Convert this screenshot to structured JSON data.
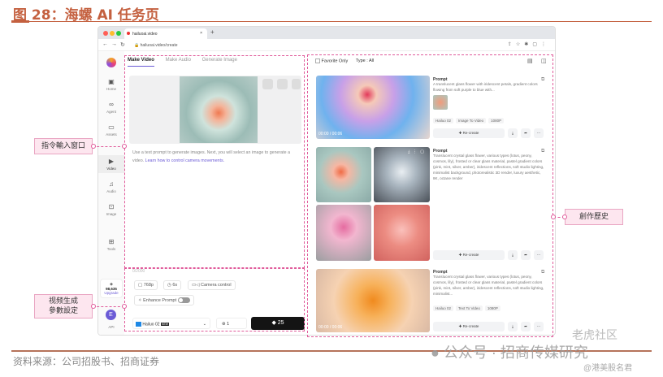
{
  "figure": {
    "title": "图 28：海螺 AI 任务页",
    "source": "资料来源：公司招股书、招商证券",
    "watermark1": "公众号 · 招商传媒研究",
    "watermark2": "@港美股名君",
    "watermark3": "老虎社区"
  },
  "annotations": {
    "input": "指令輸入窗口",
    "history": "創作歷史",
    "params_line1": "视频生成",
    "params_line2": "參數設定"
  },
  "browser": {
    "tab_title": "hailuoai.video",
    "url": "hailuoai.video/create",
    "new_tab": "+",
    "close": "×"
  },
  "sidebar": {
    "items": [
      {
        "label": "Home",
        "icon": "calendar-icon"
      },
      {
        "label": "Agent",
        "icon": "infinity-icon"
      },
      {
        "label": "Assets",
        "icon": "folder-icon"
      },
      {
        "label": "Video",
        "icon": "video-icon"
      },
      {
        "label": "Audio",
        "icon": "audio-icon"
      },
      {
        "label": "Image",
        "icon": "image-icon"
      },
      {
        "label": "Tools",
        "icon": "grid-icon"
      }
    ],
    "credits": "98,635",
    "upgrade": "Upgrade",
    "avatar": "E",
    "api": "API"
  },
  "create": {
    "tabs": [
      "Make Video",
      "Make Audio",
      "Generate Image"
    ],
    "active_tab": 0,
    "hint": "Use a text prompt to generate images. Next, you will select an image to generate a video.",
    "hint_link": "Learn how to control camera movements.",
    "char_count": "0/2000",
    "resolution": "768p",
    "duration": "6s",
    "camera": "Camera control",
    "enhance": "Enhance Prompt",
    "enhance_on": false,
    "model": "Hailuo 02",
    "model_badge": "NEW",
    "count": "1",
    "cost": "25"
  },
  "history": {
    "favorite_only": "Favorite Only",
    "type_label": "Type",
    "type_value": "All",
    "items": [
      {
        "prompt_label": "Prompt",
        "prompt": "A translucent glass flower with iridescent petals, gradient colors flowing from soft purple to blue with...",
        "tags": [
          "Hailuo 02",
          "Image To Video",
          "1080P"
        ],
        "recreate": "Re-create",
        "duration": "00:00 / 00:06"
      },
      {
        "prompt_label": "Prompt",
        "prompt": "Translucent crystal glass flower, various types (lotus, peony, cosmos, lily), frosted or clear glass material, pastel gradient colors (pink, mint, silver, amber), iridescent reflections, soft studio lighting, minimalist background, photorealistic 3D render, luxury aesthetic, 8K, octane render",
        "tags": [],
        "recreate": "Re-create"
      },
      {
        "prompt_label": "Prompt",
        "prompt": "Translucent crystal glass flower, various types (lotus, peony, cosmos, lily), frosted or clear glass material, pastel gradient colors (pink, mint, silver, amber), iridescent reflections, soft studio lighting, minimalist...",
        "tags": [
          "Hailuo 02",
          "Text To Video",
          "1080P"
        ],
        "recreate": "Re-create",
        "duration": "00:00 / 00:06"
      }
    ]
  },
  "colors": {
    "title": "#c4603f",
    "annotation": "#e05a9a",
    "accent": "#6b5bd6"
  }
}
